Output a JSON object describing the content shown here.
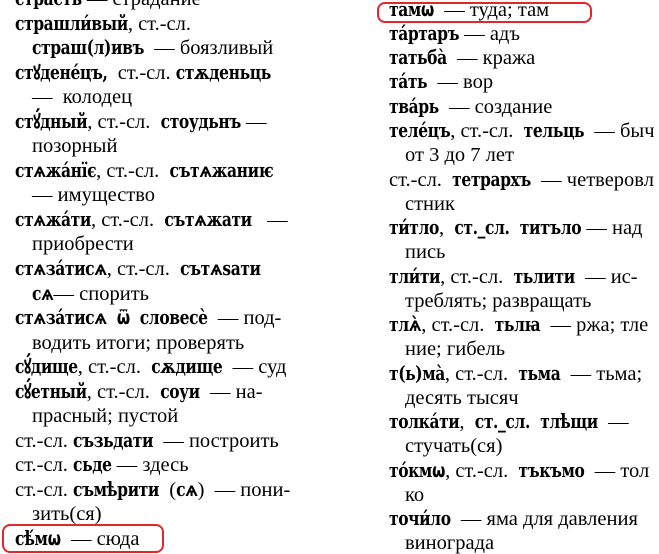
{
  "text_color": "#000000",
  "highlight_color": "#e3262e",
  "columns": {
    "left": {
      "lines": [
        {
          "continuation": false,
          "segments": [
            {
              "lang": "cu",
              "text": "страсть"
            },
            {
              "lang": "ru",
              "text": " — страдание"
            }
          ]
        },
        {
          "continuation": false,
          "segments": [
            {
              "lang": "cu",
              "text": "страшли́вый"
            },
            {
              "lang": "ru",
              "text": ", ст.-сл."
            }
          ]
        },
        {
          "continuation": true,
          "segments": [
            {
              "lang": "cu",
              "text": "страш(л)ивъ"
            },
            {
              "lang": "ru",
              "text": "  — боязливый"
            }
          ]
        },
        {
          "continuation": false,
          "segments": [
            {
              "lang": "cu",
              "text": "стꙋдене́цъ,"
            },
            {
              "lang": "ru",
              "text": "  ст.-сл. "
            },
            {
              "lang": "cu",
              "text": "стѫденьць"
            }
          ]
        },
        {
          "continuation": true,
          "segments": [
            {
              "lang": "ru",
              "text": "—  колодец"
            }
          ]
        },
        {
          "continuation": false,
          "segments": [
            {
              "lang": "cu",
              "text": "стꙋ́дный"
            },
            {
              "lang": "ru",
              "text": ", ст.-сл.  "
            },
            {
              "lang": "cu",
              "text": "стоудьнъ"
            },
            {
              "lang": "ru",
              "text": " —"
            }
          ]
        },
        {
          "continuation": true,
          "segments": [
            {
              "lang": "ru",
              "text": "позорный"
            }
          ]
        },
        {
          "continuation": false,
          "segments": [
            {
              "lang": "cu",
              "text": "стѧжа́нїє"
            },
            {
              "lang": "ru",
              "text": ", ст.-сл.  "
            },
            {
              "lang": "cu",
              "text": "сътѧжаниѥ"
            }
          ]
        },
        {
          "continuation": true,
          "segments": [
            {
              "lang": "ru",
              "text": "— имущество"
            }
          ]
        },
        {
          "continuation": false,
          "segments": [
            {
              "lang": "cu",
              "text": "стѧжа́ти"
            },
            {
              "lang": "ru",
              "text": ", ст.-сл.  "
            },
            {
              "lang": "cu",
              "text": "сътѧжати"
            },
            {
              "lang": "ru",
              "text": "   —"
            }
          ]
        },
        {
          "continuation": true,
          "segments": [
            {
              "lang": "ru",
              "text": "приобрести"
            }
          ]
        },
        {
          "continuation": false,
          "segments": [
            {
              "lang": "cu",
              "text": "стѧза́тисѧ"
            },
            {
              "lang": "ru",
              "text": ", ст.-сл.  "
            },
            {
              "lang": "cu",
              "text": "сътѧѕати"
            }
          ]
        },
        {
          "continuation": true,
          "segments": [
            {
              "lang": "cu",
              "text": "сѧ"
            },
            {
              "lang": "ru",
              "text": "— спорить"
            }
          ]
        },
        {
          "continuation": false,
          "segments": [
            {
              "lang": "cu",
              "text": "стѧза́тисѧ  ѿ  словесѐ"
            },
            {
              "lang": "ru",
              "text": "  — под-"
            }
          ]
        },
        {
          "continuation": true,
          "segments": [
            {
              "lang": "ru",
              "text": "водить итоги; проверять"
            }
          ]
        },
        {
          "continuation": false,
          "segments": [
            {
              "lang": "cu",
              "text": "сꙋ́дище"
            },
            {
              "lang": "ru",
              "text": ", ст.-сл.  "
            },
            {
              "lang": "cu",
              "text": "сѫдище"
            },
            {
              "lang": "ru",
              "text": "  — суд"
            }
          ]
        },
        {
          "continuation": false,
          "segments": [
            {
              "lang": "cu",
              "text": "сꙋ́етный"
            },
            {
              "lang": "ru",
              "text": ", ст.-сл.  "
            },
            {
              "lang": "cu",
              "text": "соуи"
            },
            {
              "lang": "ru",
              "text": "  — на-"
            }
          ]
        },
        {
          "continuation": true,
          "segments": [
            {
              "lang": "ru",
              "text": "прасный; пустой"
            }
          ]
        },
        {
          "continuation": false,
          "segments": [
            {
              "lang": "ru",
              "text": "ст.-сл. "
            },
            {
              "lang": "cu",
              "text": "съзьдати"
            },
            {
              "lang": "ru",
              "text": "  — построить"
            }
          ]
        },
        {
          "continuation": false,
          "segments": [
            {
              "lang": "ru",
              "text": "ст.-сл. "
            },
            {
              "lang": "cu",
              "text": "сьде"
            },
            {
              "lang": "ru",
              "text": " — здесь"
            }
          ]
        },
        {
          "continuation": false,
          "segments": [
            {
              "lang": "ru",
              "text": "ст.-сл. "
            },
            {
              "lang": "cu",
              "text": "съмѣрити"
            },
            {
              "lang": "ru",
              "text": "  ("
            },
            {
              "lang": "cu",
              "text": "сѧ"
            },
            {
              "lang": "ru",
              "text": ")  — пони-"
            }
          ]
        },
        {
          "continuation": true,
          "segments": [
            {
              "lang": "ru",
              "text": "зить(ся)"
            }
          ]
        },
        {
          "continuation": false,
          "highlighted": true,
          "segments": [
            {
              "lang": "cu",
              "text": "сѣ́мѡ"
            },
            {
              "lang": "ru",
              "text": "  — сюда"
            }
          ]
        }
      ]
    },
    "right": {
      "lines": [
        {
          "continuation": false,
          "highlighted": true,
          "segments": [
            {
              "lang": "cu",
              "text": "тамѡ"
            },
            {
              "lang": "ru",
              "text": "  — туда; там"
            }
          ]
        },
        {
          "continuation": false,
          "segments": [
            {
              "lang": "cu",
              "text": "та́ртаръ"
            },
            {
              "lang": "ru",
              "text": " — адъ"
            }
          ]
        },
        {
          "continuation": false,
          "segments": [
            {
              "lang": "cu",
              "text": "татьба̀"
            },
            {
              "lang": "ru",
              "text": "  — кража"
            }
          ]
        },
        {
          "continuation": false,
          "segments": [
            {
              "lang": "cu",
              "text": "та́ть"
            },
            {
              "lang": "ru",
              "text": "  — вор"
            }
          ]
        },
        {
          "continuation": false,
          "segments": [
            {
              "lang": "cu",
              "text": "тва́рь"
            },
            {
              "lang": "ru",
              "text": "  — создание"
            }
          ]
        },
        {
          "continuation": false,
          "segments": [
            {
              "lang": "cu",
              "text": "теле́цъ"
            },
            {
              "lang": "ru",
              "text": ", ст.-сл.  "
            },
            {
              "lang": "cu",
              "text": "тельць"
            },
            {
              "lang": "ru",
              "text": "  — быч"
            }
          ]
        },
        {
          "continuation": true,
          "segments": [
            {
              "lang": "ru",
              "text": "от 3 до 7 лет"
            }
          ]
        },
        {
          "continuation": false,
          "segments": [
            {
              "lang": "ru",
              "text": "ст.-сл.  "
            },
            {
              "lang": "cu",
              "text": "тетрархъ"
            },
            {
              "lang": "ru",
              "text": "  — четверовл"
            }
          ]
        },
        {
          "continuation": true,
          "segments": [
            {
              "lang": "ru",
              "text": "стник"
            }
          ]
        },
        {
          "continuation": false,
          "segments": [
            {
              "lang": "cu",
              "text": "ти́тло"
            },
            {
              "lang": "ru",
              "text": ",  "
            },
            {
              "lang": "cu",
              "text": "ст._сл."
            },
            {
              "lang": "ru",
              "text": "  "
            },
            {
              "lang": "cu",
              "text": "титъло"
            },
            {
              "lang": "ru",
              "text": " — над"
            }
          ]
        },
        {
          "continuation": true,
          "segments": [
            {
              "lang": "ru",
              "text": "пись"
            }
          ]
        },
        {
          "continuation": false,
          "segments": [
            {
              "lang": "cu",
              "text": "тли́ти"
            },
            {
              "lang": "ru",
              "text": ", ст.-сл.  "
            },
            {
              "lang": "cu",
              "text": "тьлити"
            },
            {
              "lang": "ru",
              "text": "  — ис-"
            }
          ]
        },
        {
          "continuation": true,
          "segments": [
            {
              "lang": "ru",
              "text": "треблять; развращать"
            }
          ]
        },
        {
          "continuation": false,
          "segments": [
            {
              "lang": "cu",
              "text": "тлѧ̀"
            },
            {
              "lang": "ru",
              "text": ", ст.-сл.  "
            },
            {
              "lang": "cu",
              "text": "тьлꙗ"
            },
            {
              "lang": "ru",
              "text": "  — ржа; тле"
            }
          ]
        },
        {
          "continuation": true,
          "segments": [
            {
              "lang": "ru",
              "text": "ние; гибель"
            }
          ]
        },
        {
          "continuation": false,
          "segments": [
            {
              "lang": "cu",
              "text": "т(ь)ма̀"
            },
            {
              "lang": "ru",
              "text": ", ст.-сл.  "
            },
            {
              "lang": "cu",
              "text": "тьма"
            },
            {
              "lang": "ru",
              "text": "  — тьма;"
            }
          ]
        },
        {
          "continuation": true,
          "segments": [
            {
              "lang": "ru",
              "text": "десять тысяч"
            }
          ]
        },
        {
          "continuation": false,
          "segments": [
            {
              "lang": "cu",
              "text": "толка́ти"
            },
            {
              "lang": "ru",
              "text": ",  "
            },
            {
              "lang": "cu",
              "text": "ст._сл."
            },
            {
              "lang": "ru",
              "text": "  "
            },
            {
              "lang": "cu",
              "text": "тлѣщи"
            },
            {
              "lang": "ru",
              "text": "  —"
            }
          ]
        },
        {
          "continuation": true,
          "segments": [
            {
              "lang": "ru",
              "text": "стучать(ся)"
            }
          ]
        },
        {
          "continuation": false,
          "segments": [
            {
              "lang": "cu",
              "text": "то́кмѡ"
            },
            {
              "lang": "ru",
              "text": ", ст.-сл.  "
            },
            {
              "lang": "cu",
              "text": "тъкъмо"
            },
            {
              "lang": "ru",
              "text": "  — тол"
            }
          ]
        },
        {
          "continuation": true,
          "segments": [
            {
              "lang": "ru",
              "text": "ко"
            }
          ]
        },
        {
          "continuation": false,
          "segments": [
            {
              "lang": "cu",
              "text": "точи́ло"
            },
            {
              "lang": "ru",
              "text": "  — яма для давления"
            }
          ]
        },
        {
          "continuation": true,
          "segments": [
            {
              "lang": "ru",
              "text": "винограда"
            }
          ]
        }
      ]
    }
  }
}
